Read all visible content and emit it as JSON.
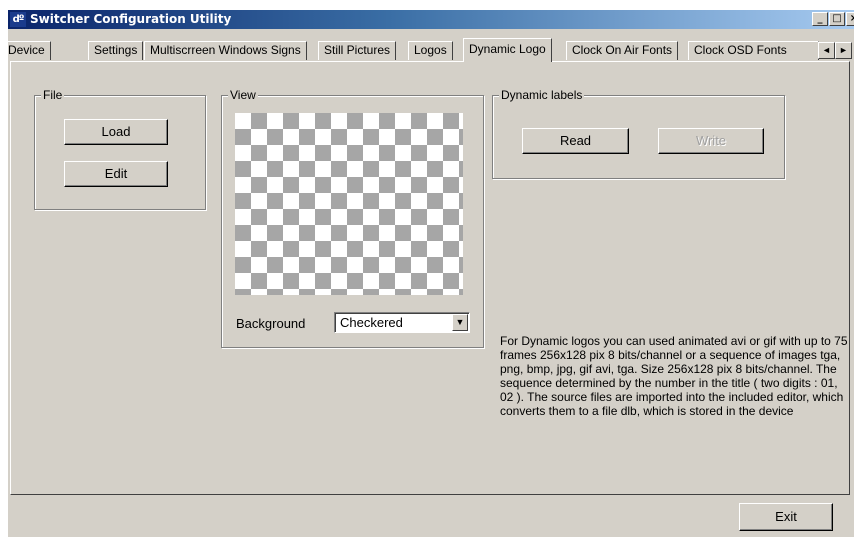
{
  "window": {
    "title": "Switcher Configuration Utility",
    "icon_text": "dº"
  },
  "caption_buttons": {
    "minimize": "_",
    "maximize": "□",
    "close": "×"
  },
  "tabs": [
    {
      "label": "Device"
    },
    {
      "label": "Settings"
    },
    {
      "label": "Multiscrreen Windows Signs"
    },
    {
      "label": "Still Pictures"
    },
    {
      "label": "Logos"
    },
    {
      "label": "Dynamic Logo",
      "active": true
    },
    {
      "label": "Clock On Air Fonts"
    },
    {
      "label": "Clock OSD Fonts"
    }
  ],
  "tab_scroll": {
    "left": "◄",
    "right": "►"
  },
  "file_group": {
    "title": "File",
    "load": "Load",
    "edit": "Edit"
  },
  "view_group": {
    "title": "View",
    "background_label": "Background",
    "background_value": "Checkered",
    "dropdown_arrow": "▼"
  },
  "dynamic_labels_group": {
    "title": "Dynamic labels",
    "read": "Read",
    "write": "Write"
  },
  "info_text": "For Dynamic logos you can used  animated  avi or gif with up to 75 frames  256x128 pix 8 bits/channel  or a sequence of  images tga, png, bmp, jpg, gif avi, tga. Size 256x128 pix 8 bits/channel. The sequence determined by the number in the title ( two digits  : 01, 02 ). The source files are imported into the included editor, which converts them to a file dlb, which is stored in the device",
  "exit_button": "Exit",
  "colors": {
    "titlebar_start": "#0a246a",
    "titlebar_end": "#a6caf0",
    "face": "#d4d0c8",
    "checker": "#a6a6a6"
  }
}
